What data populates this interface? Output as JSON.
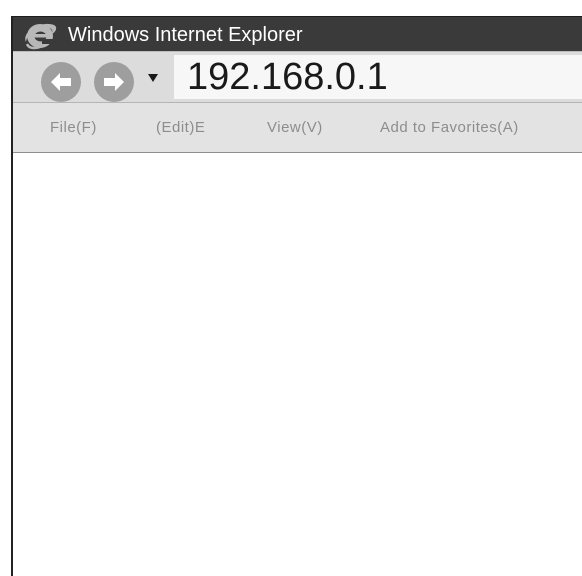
{
  "window": {
    "title": "Windows Internet Explorer",
    "logo_icon": "internet-explorer-logo-icon"
  },
  "navigation": {
    "back_icon": "back-arrow-icon",
    "forward_icon": "forward-arrow-icon",
    "dropdown_icon": "dropdown-triangle-icon",
    "address": "192.168.0.1"
  },
  "menu": {
    "items": [
      {
        "label": "File(F)"
      },
      {
        "label": "(Edit)E"
      },
      {
        "label": "View(V)"
      },
      {
        "label": "Add to Favorites(A)"
      }
    ]
  },
  "colors": {
    "titlebar": "#3a3a3a",
    "navbar": "#dcdcdc",
    "menubar": "#e3e3e3",
    "nav_buttons": "#9e9e9e",
    "menu_text": "#8d8d8d"
  }
}
